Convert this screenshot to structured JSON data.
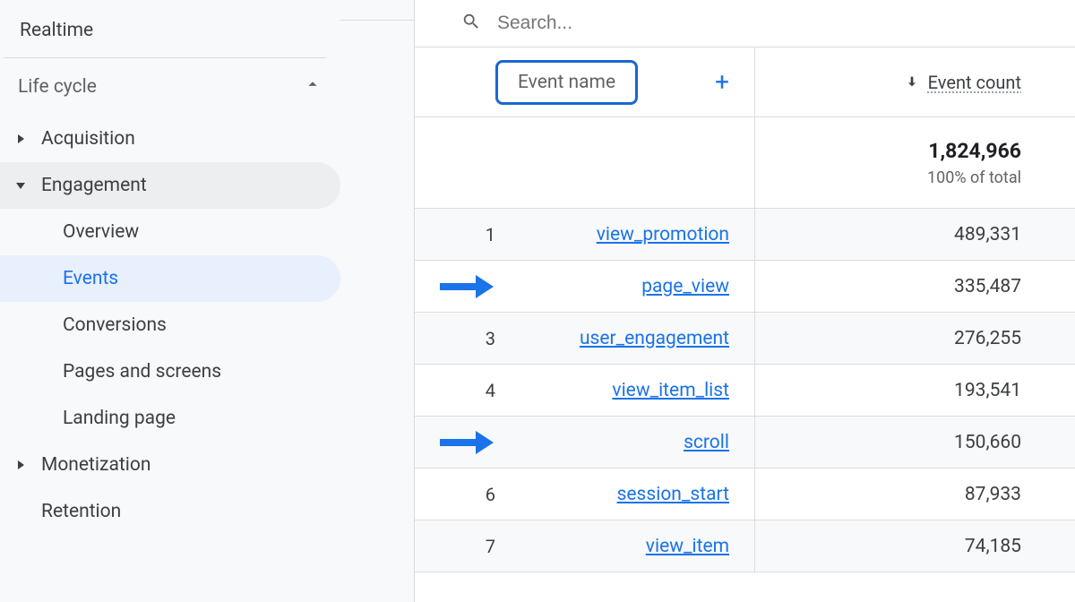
{
  "sidebar": {
    "realtime": "Realtime",
    "section_title": "Life cycle",
    "items": {
      "acquisition": "Acquisition",
      "engagement": "Engagement",
      "monetization": "Monetization",
      "retention": "Retention"
    },
    "engagement_sub": {
      "overview": "Overview",
      "events": "Events",
      "conversions": "Conversions",
      "pages_screens": "Pages and screens",
      "landing_page": "Landing page"
    }
  },
  "search": {
    "placeholder": "Search..."
  },
  "table": {
    "header": {
      "event_name": "Event name",
      "event_count": "Event count"
    },
    "totals": {
      "count": "1,824,966",
      "pct": "100% of total"
    },
    "rows": [
      {
        "rank": "1",
        "name": "view_promotion",
        "count": "489,331",
        "highlight": false
      },
      {
        "rank": "",
        "name": "page_view",
        "count": "335,487",
        "highlight": true
      },
      {
        "rank": "3",
        "name": "user_engagement",
        "count": "276,255",
        "highlight": false
      },
      {
        "rank": "4",
        "name": "view_item_list",
        "count": "193,541",
        "highlight": false
      },
      {
        "rank": "",
        "name": "scroll",
        "count": "150,660",
        "highlight": true
      },
      {
        "rank": "6",
        "name": "session_start",
        "count": "87,933",
        "highlight": false
      },
      {
        "rank": "7",
        "name": "view_item",
        "count": "74,185",
        "highlight": false
      }
    ]
  }
}
